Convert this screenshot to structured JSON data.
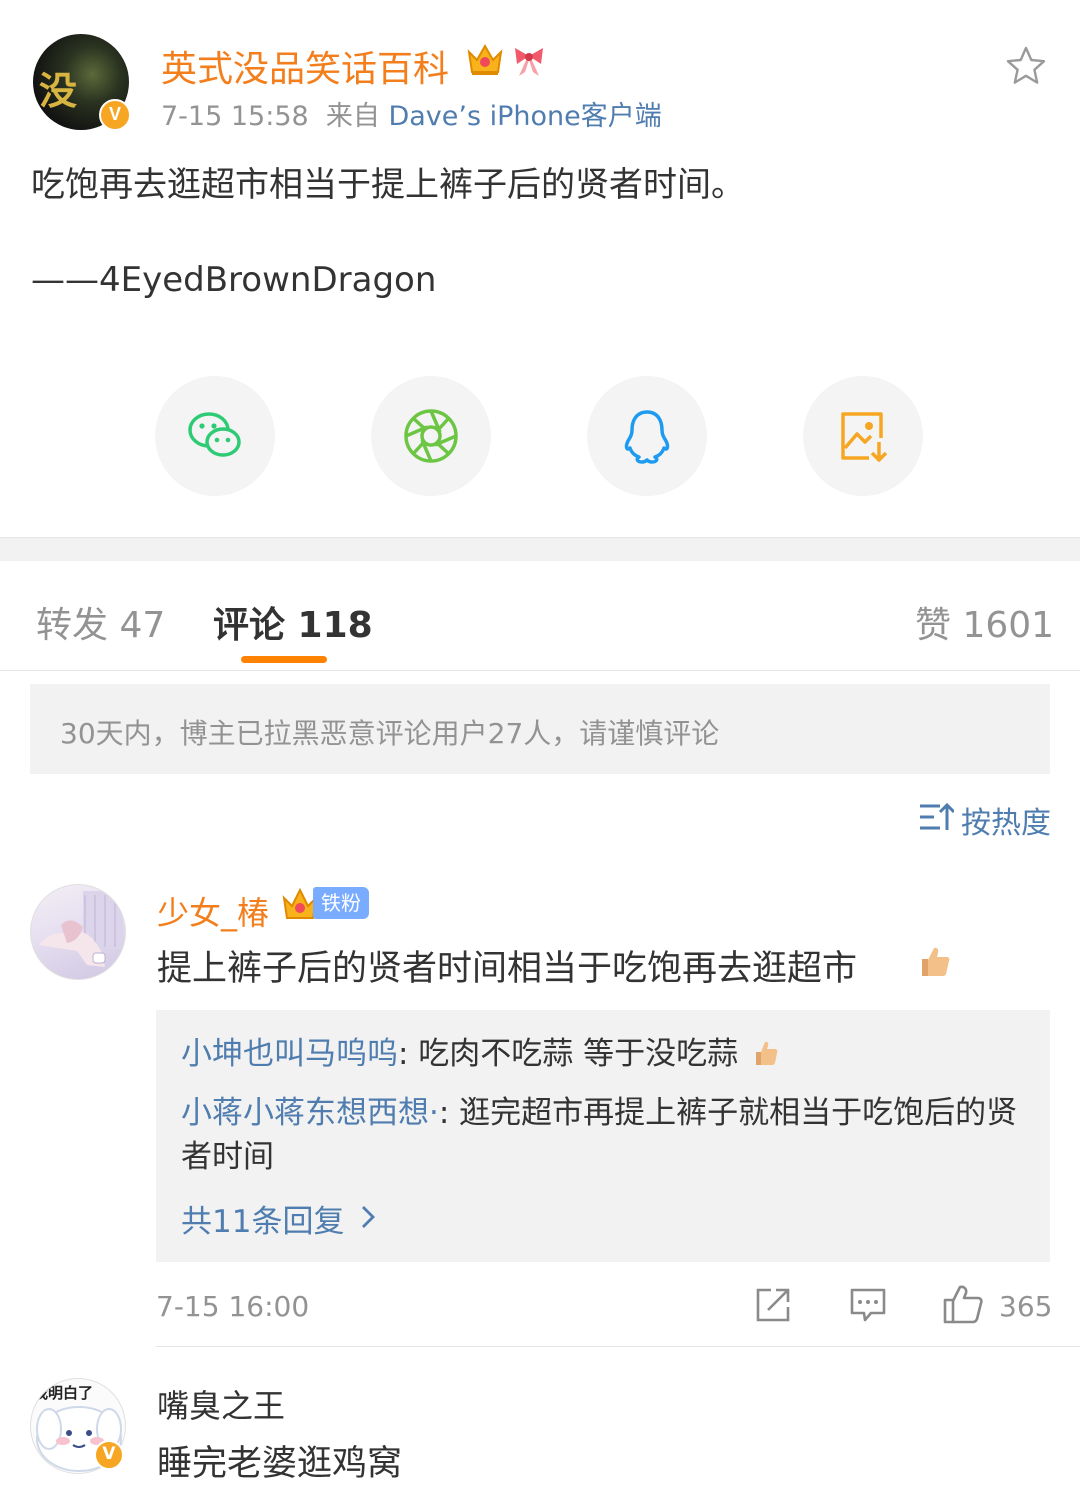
{
  "post": {
    "author": "英式没品笑话百科",
    "avatar_text": "没",
    "verified_badge": "V",
    "time": "7-15 15:58",
    "source_prefix": "来自",
    "source": "Dave’s iPhone客户端",
    "text": "吃饱再去逛超市相当于提上裤子后的贤者时间。",
    "signature": "——4EyedBrownDragon",
    "icons": [
      "crown-icon",
      "bow-icon",
      "favorite-star-icon"
    ]
  },
  "share": {
    "targets": [
      {
        "name": "wechat",
        "icon": "wechat-icon",
        "color": "#2ecb74"
      },
      {
        "name": "moments",
        "icon": "moments-icon",
        "color": "#6cc644"
      },
      {
        "name": "qq",
        "icon": "qq-icon",
        "color": "#1e9bf0"
      },
      {
        "name": "save-image",
        "icon": "save-image-icon",
        "color": "#f6a623"
      }
    ]
  },
  "tabs": {
    "repost": "转发 47",
    "comment": "评论 118",
    "likes": "赞 1601",
    "active_color": "#ff8200"
  },
  "notice": "30天内，博主已拉黑恶意评论用户27人，请谨慎评论",
  "sort": {
    "label": "按热度",
    "icon": "sort-icon"
  },
  "comments": [
    {
      "user": "少女_椿",
      "fan_badge": "铁粉",
      "text": "提上裤子后的贤者时间相当于吃饱再去逛超市",
      "emoji": "thumbs-up-icon",
      "replies": [
        {
          "user": "小坤也叫马呜呜",
          "text": ": 吃肉不吃蒜 等于没吃蒜"
        },
        {
          "user": "小蒋小蒋东想西想·",
          "text": ": 逛完超市再提上裤子就相当于吃饱后的贤者时间"
        }
      ],
      "more_replies": "共11条回复",
      "time": "7-15 16:00",
      "like_count": "365"
    },
    {
      "user": "嘴臭之王",
      "avatar_text": "我明白了",
      "verified_badge": "V",
      "text": "睡完老婆逛鸡窝"
    }
  ],
  "colors": {
    "author_orange": "#f37e1b",
    "link_blue": "#507daf",
    "grey_text": "#939393",
    "panel_grey": "#f2f2f2"
  }
}
